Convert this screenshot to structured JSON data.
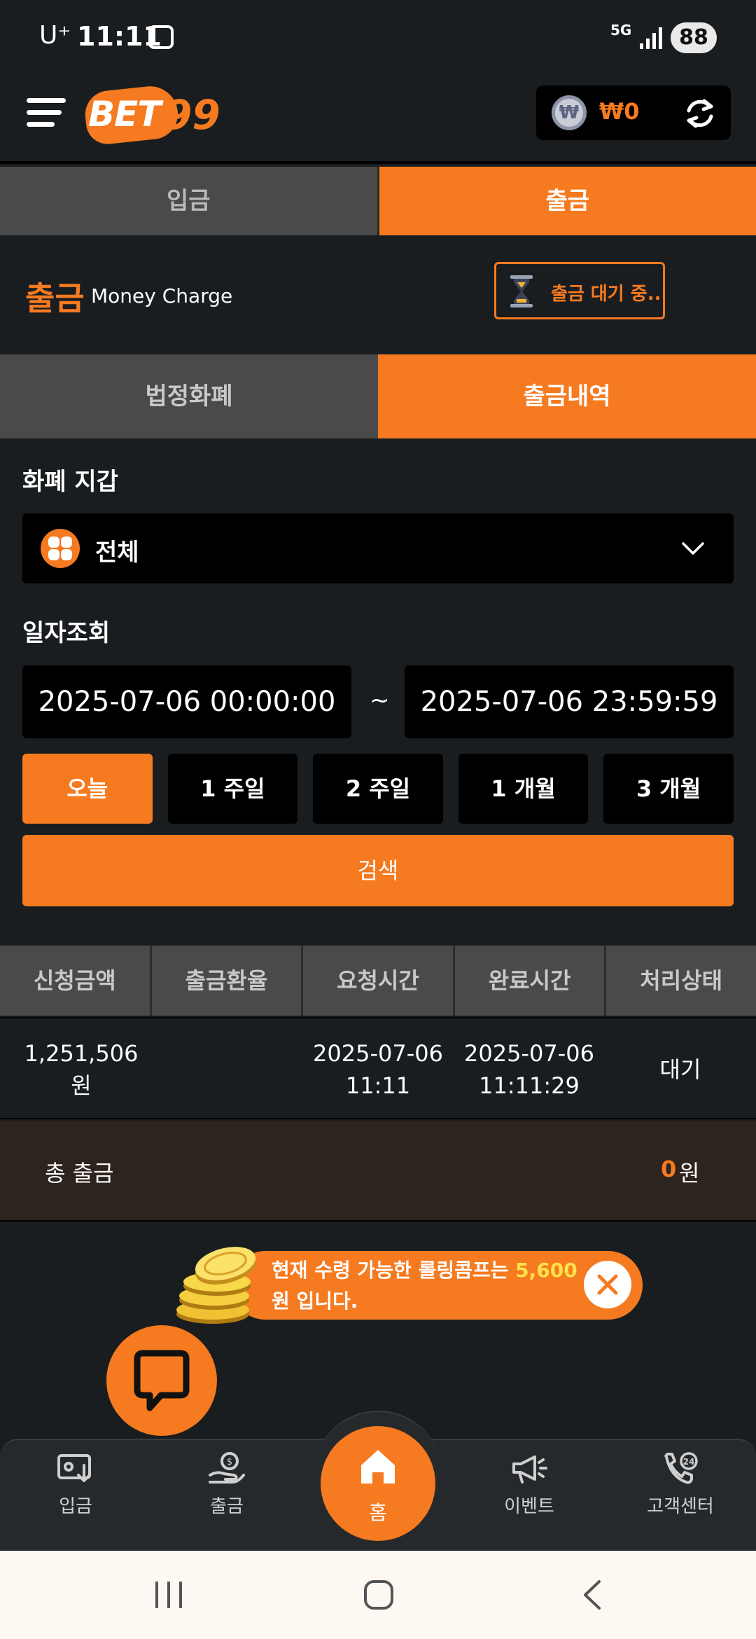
{
  "status_bar": {
    "carrier": "U⁺",
    "time": "11:11",
    "network": "5G",
    "battery": "88"
  },
  "header": {
    "logo_text_bet": "BET",
    "logo_text_99": "99",
    "wallet_amount": "₩0",
    "won_symbol": "₩"
  },
  "top_tabs": [
    {
      "label": "입금",
      "active": false
    },
    {
      "label": "출금",
      "active": true
    }
  ],
  "title": {
    "main": "출금",
    "sub": "Money Charge",
    "pending_label": "출금 대기 중.."
  },
  "sub_tabs": [
    {
      "label": "법정화폐",
      "active": false
    },
    {
      "label": "출금내역",
      "active": true
    }
  ],
  "wallet_section": {
    "label": "화폐 지갑",
    "selected": "전체"
  },
  "date_section": {
    "label": "일자조회",
    "start": "2025-07-06 00:00:00",
    "separator": "~",
    "end": "2025-07-06 23:59:59",
    "ranges": [
      {
        "label": "오늘",
        "active": true
      },
      {
        "label": "1 주일",
        "active": false
      },
      {
        "label": "2 주일",
        "active": false
      },
      {
        "label": "1 개월",
        "active": false
      },
      {
        "label": "3 개월",
        "active": false
      }
    ],
    "search_label": "검색"
  },
  "table": {
    "headers": [
      "신청금액",
      "출금환율",
      "요청시간",
      "완료시간",
      "처리상태"
    ],
    "rows": [
      {
        "amount": "1,251,506 원",
        "rate": "",
        "request_date": "2025-07-06",
        "request_time": "11:11",
        "complete_date": "2025-07-06",
        "complete_time": "11:11:29",
        "status": "대기"
      }
    ]
  },
  "total": {
    "label": "총 출금",
    "value": "0",
    "unit": "원"
  },
  "promo": {
    "text_before": "현재 수령 가능한 롤링콤프는 ",
    "amount": "5,600",
    "text_after": " 원 입니다."
  },
  "bottom_nav": [
    {
      "label": "입금",
      "icon": "deposit-icon"
    },
    {
      "label": "출금",
      "icon": "withdraw-icon"
    },
    {
      "label": "홈",
      "icon": "home-icon"
    },
    {
      "label": "이벤트",
      "icon": "megaphone-icon"
    },
    {
      "label": "고객센터",
      "icon": "phone-24-icon"
    }
  ],
  "colors": {
    "accent": "#f57a20",
    "background": "#1a1d20",
    "inactive_tab": "#4a4a4a",
    "highlight": "#ffe24a"
  }
}
